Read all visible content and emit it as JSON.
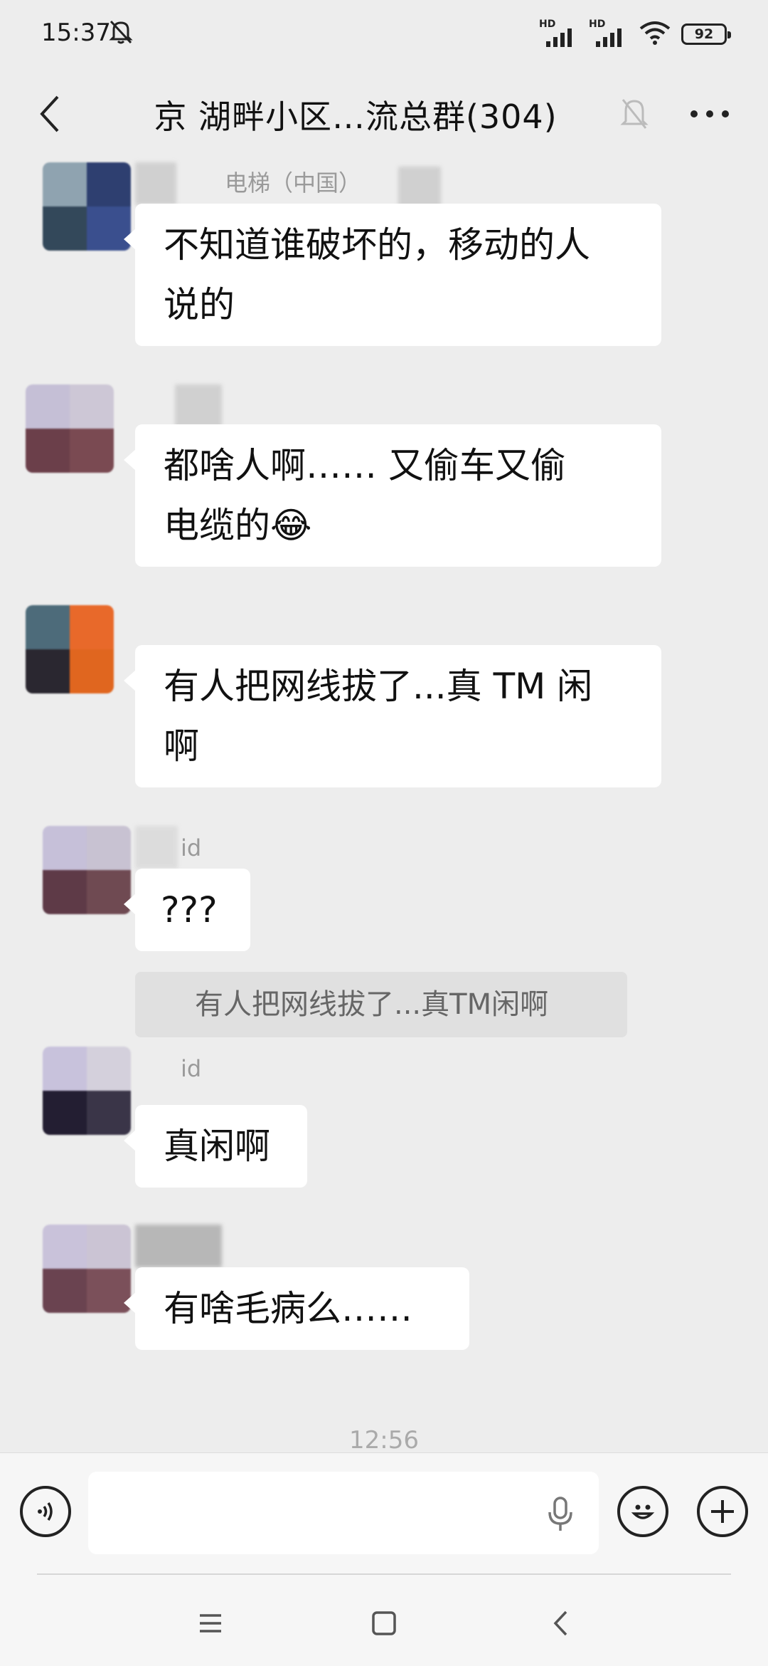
{
  "status_bar": {
    "time": "15:37",
    "signal1_label": "HD",
    "signal2_label": "HD",
    "battery": "92"
  },
  "header": {
    "title": "京  湖畔小区…流总群(304)"
  },
  "messages": [
    {
      "sender": "电梯（中国）",
      "text_lines": [
        "不知道谁破坏的，移动的人",
        "说的"
      ]
    },
    {
      "sender": "",
      "text_lines": [
        "都啥人啊…… 又偷车又偷",
        "电缆的😂"
      ]
    },
    {
      "sender": "",
      "text_lines": [
        "有人把网线拔了...真 TM 闲",
        "啊"
      ]
    },
    {
      "sender": "id",
      "text_lines": [
        "???"
      ]
    },
    {
      "sender": "id",
      "text_lines": [
        "真闲啊"
      ]
    },
    {
      "sender": "",
      "text_lines": [
        "有啥毛病么……"
      ]
    }
  ],
  "quote": {
    "text": "有人把网线拔了...真TM闲啊"
  },
  "timestamp": "12:56",
  "input_bar": {
    "placeholder": ""
  },
  "icons": {
    "voice": "voice-input-icon",
    "mic": "microphone-icon",
    "emoji": "emoji-icon",
    "plus": "plus-icon",
    "back": "chevron-left-icon",
    "mute": "bell-off-icon",
    "more": "more-dots-icon"
  },
  "colors": {
    "background": "#ededed",
    "bubble": "#ffffff",
    "quote": "#e0e0e0"
  }
}
